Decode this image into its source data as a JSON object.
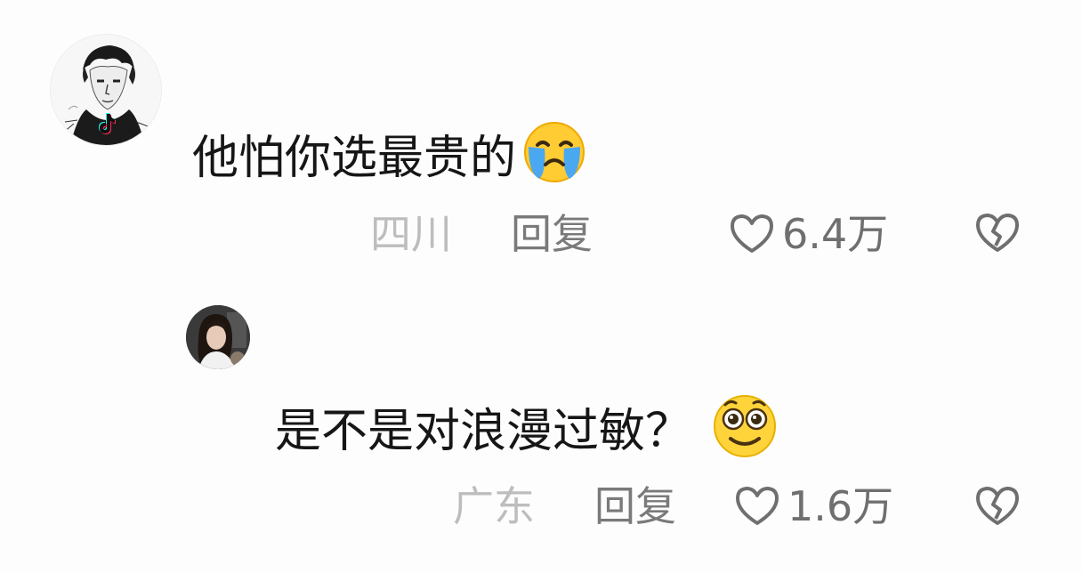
{
  "comments": [
    {
      "text": "他怕你选最贵的",
      "emoji": "loudly-crying-face",
      "location": "四川",
      "reply_label": "回复",
      "likes": "6.4万"
    },
    {
      "text": "是不是对浪漫过敏？",
      "emoji": "smiling-face-big-eyes",
      "location": "广东",
      "reply_label": "回复",
      "likes": "1.6万"
    }
  ],
  "icons": {
    "like": "heart-outline-icon",
    "dislike": "broken-heart-icon",
    "app_badge": "tiktok-logo-icon"
  },
  "colors": {
    "background": "#fdfdfd",
    "comment_text": "#161616",
    "location_text": "#bdbdbd",
    "reply_text": "#7a7a7a",
    "icon": "#6f6f6f"
  }
}
